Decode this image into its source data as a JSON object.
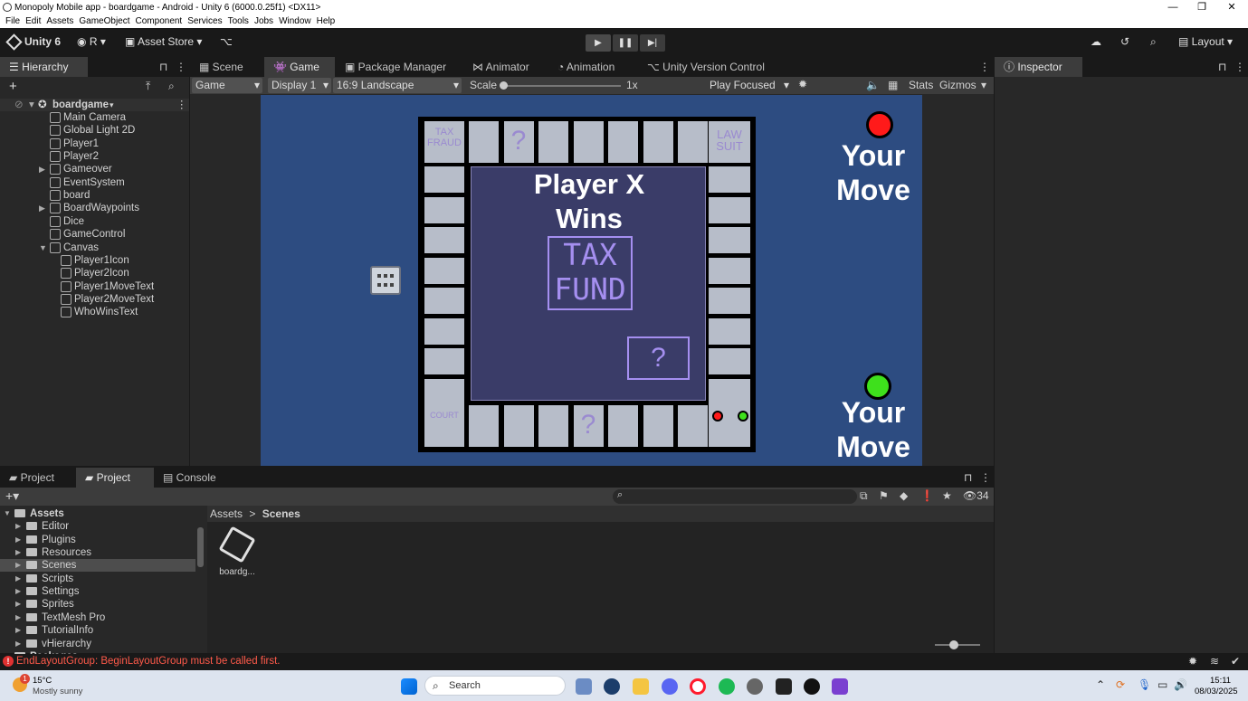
{
  "window": {
    "title": "Monopoly Mobile app - boardgame - Android - Unity 6 (6000.0.25f1) <DX11>",
    "minimize": "—",
    "restore": "❐",
    "close": "✕"
  },
  "menu": [
    "File",
    "Edit",
    "Assets",
    "GameObject",
    "Component",
    "Services",
    "Tools",
    "Jobs",
    "Window",
    "Help"
  ],
  "toolbar": {
    "unity_label": "Unity 6",
    "account": "R",
    "asset_store": "Asset Store",
    "layout": "Layout",
    "play": "▶",
    "pause": "❚❚",
    "step": "▶|"
  },
  "hierarchy": {
    "tab": "Hierarchy",
    "scene": "boardgame",
    "items": [
      {
        "label": "Main Camera",
        "depth": 1
      },
      {
        "label": "Global Light 2D",
        "depth": 1
      },
      {
        "label": "Player1",
        "depth": 1
      },
      {
        "label": "Player2",
        "depth": 1
      },
      {
        "label": "Gameover",
        "depth": 1
      },
      {
        "label": "EventSystem",
        "depth": 1
      },
      {
        "label": "board",
        "depth": 1
      },
      {
        "label": "BoardWaypoints",
        "depth": 1
      },
      {
        "label": "Dice",
        "depth": 1
      },
      {
        "label": "GameControl",
        "depth": 1
      },
      {
        "label": "Canvas",
        "depth": 1
      },
      {
        "label": "Player1Icon",
        "depth": 2
      },
      {
        "label": "Player2Icon",
        "depth": 2
      },
      {
        "label": "Player1MoveText",
        "depth": 2
      },
      {
        "label": "Player2MoveText",
        "depth": 2
      },
      {
        "label": "WhoWinsText",
        "depth": 2
      }
    ]
  },
  "center_tabs": [
    "Scene",
    "Game",
    "Package Manager",
    "Animator",
    "Animation",
    "Unity Version Control"
  ],
  "gamebar": {
    "mode": "Game",
    "display": "Display 1",
    "aspect": "16:9 Landscape",
    "scale_label": "Scale",
    "scale_value": "1x",
    "play_focused": "Play Focused",
    "stats": "Stats",
    "gizmos": "Gizmos"
  },
  "game": {
    "winner_line1": "Player X",
    "winner_line2": "Wins",
    "tax_line1": "TAX",
    "tax_line2": "FUND",
    "chance_mark": "?",
    "corner_tl": "TAX FRAUD",
    "corner_tr": "LAW SUIT",
    "corner_bl": "COURT",
    "p1_move_1": "Your",
    "p1_move_2": "Move",
    "p2_move_1": "Your",
    "p2_move_2": "Move",
    "colors": {
      "p1": "#ff1a1a",
      "p2": "#3ee01c",
      "board_bg": "#2d4c81",
      "inner": "#3a3c68",
      "tile": "#b7bdc9"
    }
  },
  "inspector": {
    "tab": "Inspector"
  },
  "project": {
    "tabs": [
      "Project",
      "Project",
      "Console"
    ],
    "tree": [
      {
        "label": "Assets",
        "depth": 0
      },
      {
        "label": "Editor",
        "depth": 1
      },
      {
        "label": "Plugins",
        "depth": 1
      },
      {
        "label": "Resources",
        "depth": 1
      },
      {
        "label": "Scenes",
        "depth": 1
      },
      {
        "label": "Scripts",
        "depth": 1
      },
      {
        "label": "Settings",
        "depth": 1
      },
      {
        "label": "Sprites",
        "depth": 1
      },
      {
        "label": "TextMesh Pro",
        "depth": 1
      },
      {
        "label": "TutorialInfo",
        "depth": 1
      },
      {
        "label": "vHierarchy",
        "depth": 1
      },
      {
        "label": "Packages",
        "depth": 0
      }
    ],
    "breadcrumb_root": "Assets",
    "breadcrumb_sep": ">",
    "breadcrumb_current": "Scenes",
    "asset_label": "boardg...",
    "hidden_count": "34"
  },
  "status": {
    "error": "EndLayoutGroup: BeginLayoutGroup must be called first."
  },
  "taskbar": {
    "weather_temp": "15°C",
    "weather_desc": "Mostly sunny",
    "search": "Search",
    "time": "15:11",
    "date": "08/03/2025",
    "badge": "1"
  }
}
